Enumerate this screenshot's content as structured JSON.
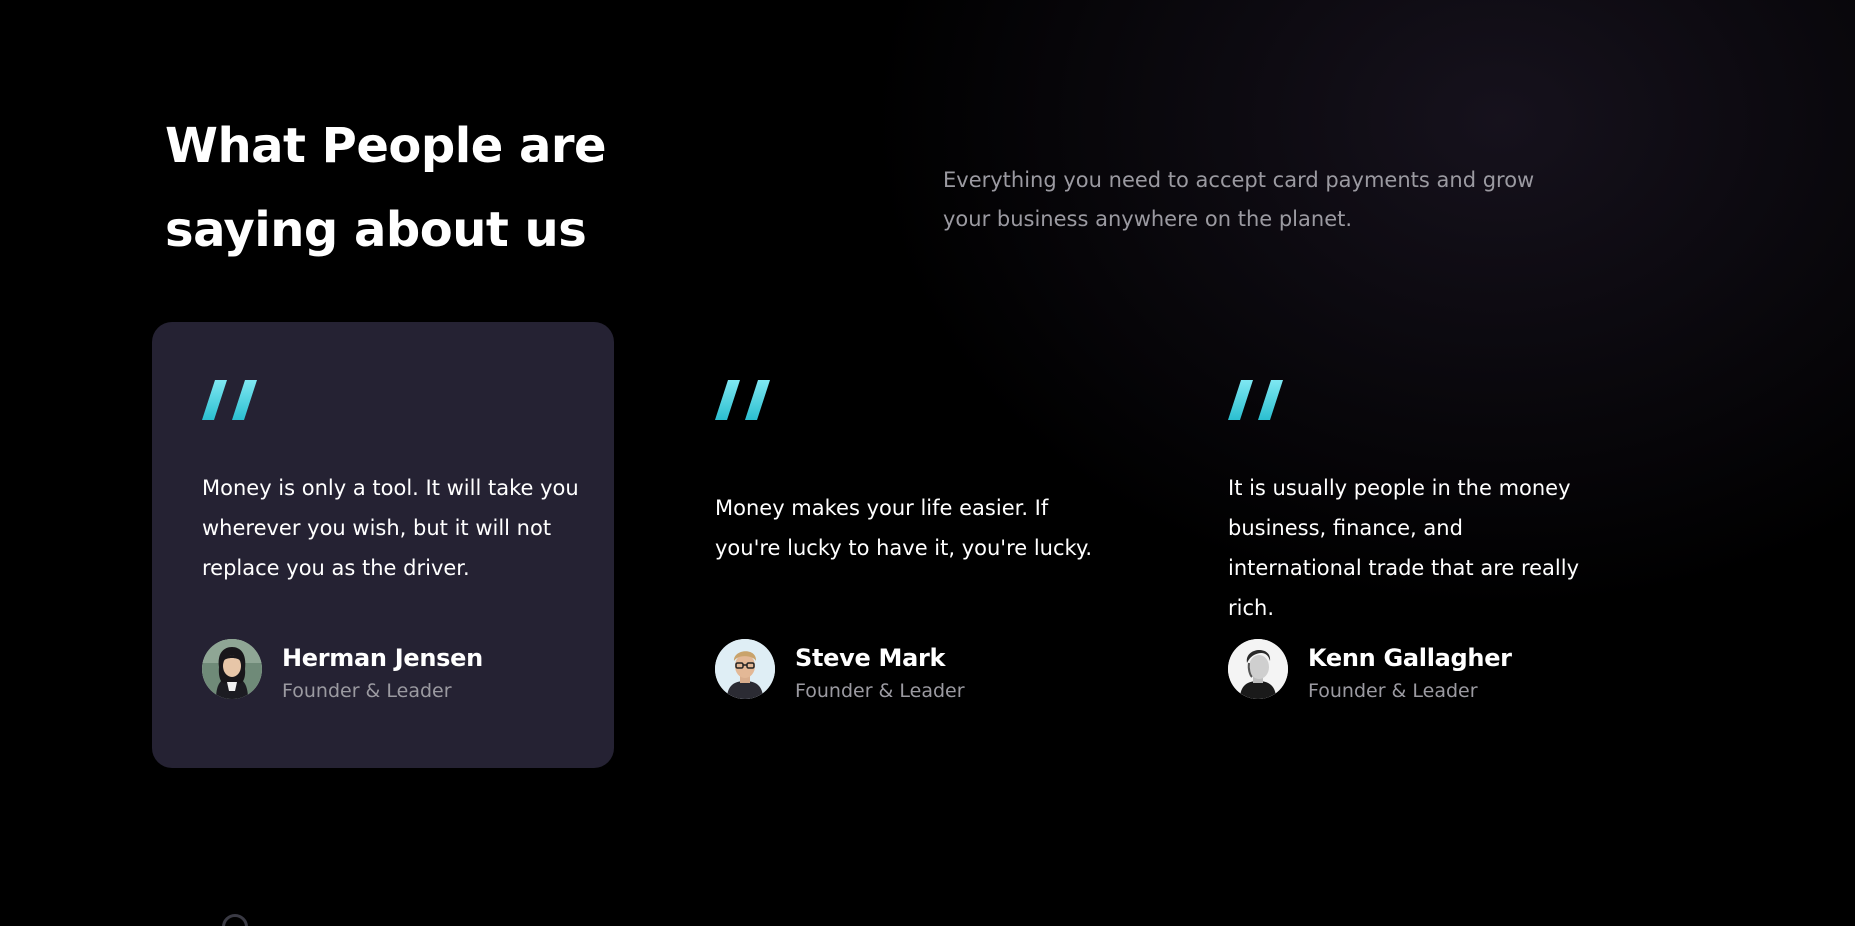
{
  "section": {
    "heading": "What People are saying about us",
    "subtitle": "Everything you need to accept card payments and grow your business anywhere on the planet."
  },
  "colors": {
    "background": "#000000",
    "card_active_bg": "#252233",
    "quote_accent_start": "#7fe8f2",
    "quote_accent_end": "#2bbfd0",
    "muted_text": "#9b9aa1"
  },
  "testimonials": [
    {
      "quote": "Money is only a tool. It will take you wherever you wish, but it will not replace you as the driver.",
      "name": "Herman Jensen",
      "role": "Founder & Leader",
      "avatar_icon": "avatar-woman-photo",
      "active": true
    },
    {
      "quote": "Money makes your life easier. If you're lucky to have it, you're lucky.",
      "name": "Steve Mark",
      "role": "Founder & Leader",
      "avatar_icon": "avatar-man-glasses-photo",
      "active": false
    },
    {
      "quote": "It is usually people in the money business, finance, and international trade that are really rich.",
      "name": "Kenn Gallagher",
      "role": "Founder & Leader",
      "avatar_icon": "avatar-man-bw-photo",
      "active": false
    }
  ]
}
